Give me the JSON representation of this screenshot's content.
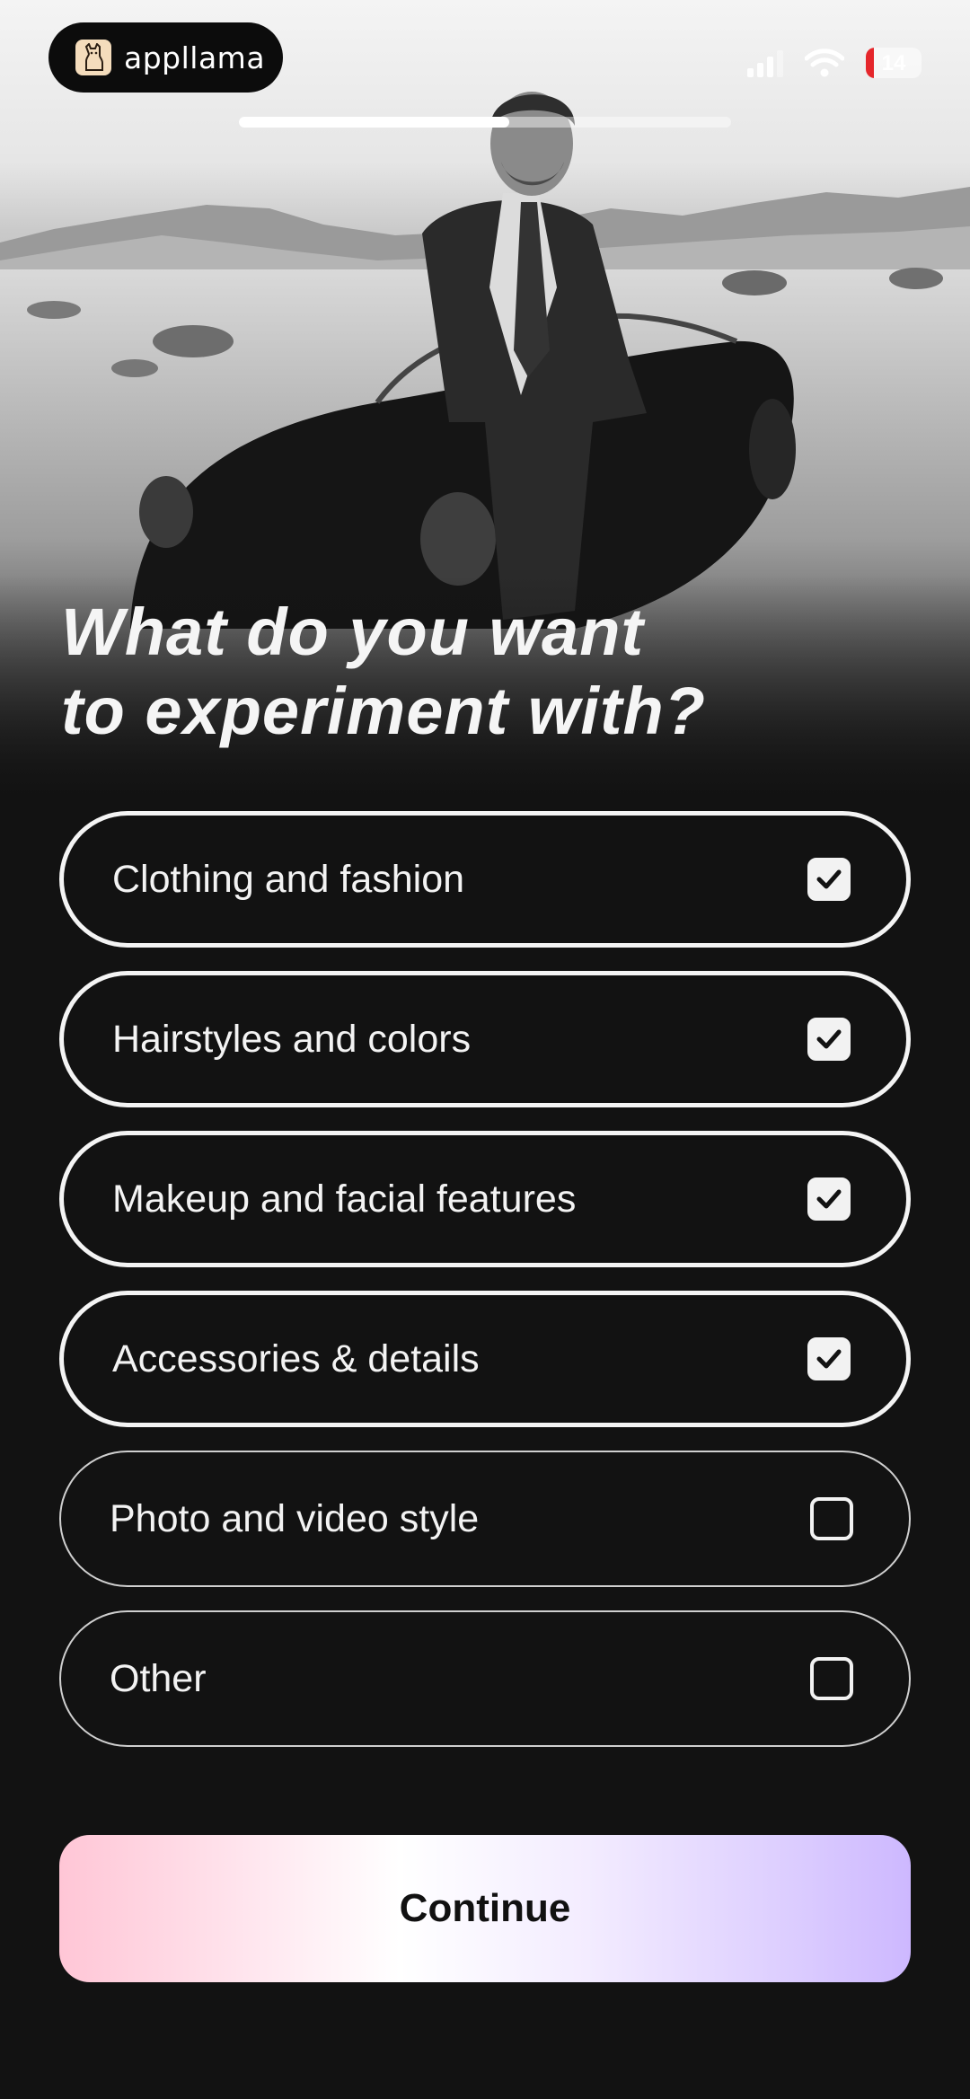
{
  "status_bar": {
    "app_name": "appllama",
    "battery_level": "14"
  },
  "progress": {
    "fraction": 0.55
  },
  "question": {
    "line1": "What do you want",
    "line2": "to experiment with?"
  },
  "options": [
    {
      "label": "Clothing and fashion",
      "checked": true
    },
    {
      "label": "Hairstyles and colors",
      "checked": true
    },
    {
      "label": "Makeup and facial features",
      "checked": true
    },
    {
      "label": "Accessories & details",
      "checked": true
    },
    {
      "label": "Photo and video style",
      "checked": false
    },
    {
      "label": "Other",
      "checked": false
    }
  ],
  "continue_label": "Continue",
  "colors": {
    "background": "#121212",
    "battery_low": "#e5262b",
    "button_gradient_start": "#ffc6d6",
    "button_gradient_end": "#cdb8ff"
  }
}
